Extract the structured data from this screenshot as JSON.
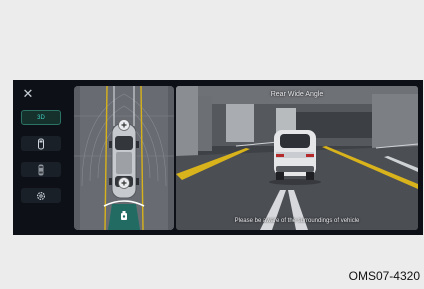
{
  "rail": {
    "close_icon": "close-icon",
    "items": [
      {
        "label": "3D",
        "active": true
      },
      {
        "icon": "car-front-view-icon",
        "active": false
      },
      {
        "icon": "car-top-view-icon",
        "active": false
      },
      {
        "icon": "settings-gear-icon",
        "active": false
      }
    ]
  },
  "surround": {
    "zoom_icons": [
      "zoom-in-icon",
      "zoom-in-icon"
    ],
    "trunk_icon": "rear-view-camera-icon"
  },
  "camera": {
    "title": "Rear Wide Angle",
    "warning": "Please be aware of the surroundings of vehicle"
  },
  "figure_code": "OMS07-4320"
}
